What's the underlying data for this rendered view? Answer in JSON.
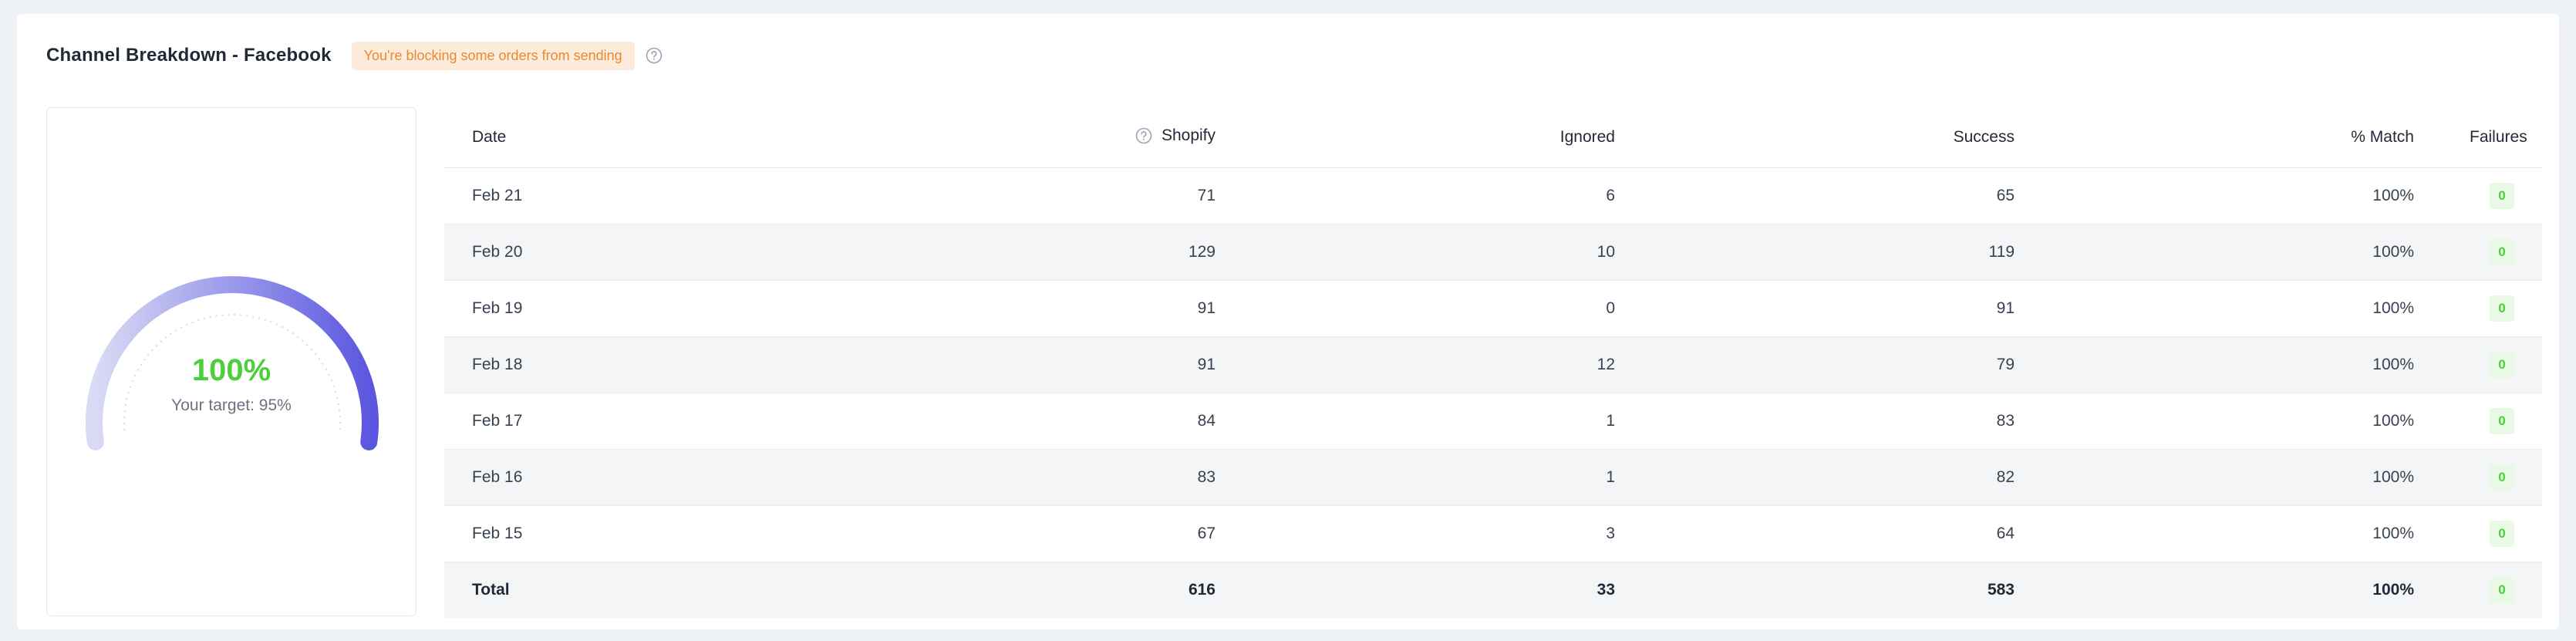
{
  "header": {
    "title": "Channel Breakdown - Facebook",
    "warning": "You're blocking some orders from sending"
  },
  "gauge": {
    "percent": 100,
    "value_label": "100%",
    "target_label": "Your target: 95%",
    "target_percent": 95,
    "colors": {
      "start": "#d9dbf5",
      "end": "#5b56e0",
      "value_text": "#4ccf3c"
    }
  },
  "table": {
    "columns": [
      "Date",
      "Shopify",
      "Ignored",
      "Success",
      "% Match",
      "Failures"
    ],
    "rows": [
      {
        "date": "Feb 21",
        "shopify": "71",
        "ignored": "6",
        "success": "65",
        "match": "100%",
        "failures": "0"
      },
      {
        "date": "Feb 20",
        "shopify": "129",
        "ignored": "10",
        "success": "119",
        "match": "100%",
        "failures": "0"
      },
      {
        "date": "Feb 19",
        "shopify": "91",
        "ignored": "0",
        "success": "91",
        "match": "100%",
        "failures": "0"
      },
      {
        "date": "Feb 18",
        "shopify": "91",
        "ignored": "12",
        "success": "79",
        "match": "100%",
        "failures": "0"
      },
      {
        "date": "Feb 17",
        "shopify": "84",
        "ignored": "1",
        "success": "83",
        "match": "100%",
        "failures": "0"
      },
      {
        "date": "Feb 16",
        "shopify": "83",
        "ignored": "1",
        "success": "82",
        "match": "100%",
        "failures": "0"
      },
      {
        "date": "Feb 15",
        "shopify": "67",
        "ignored": "3",
        "success": "64",
        "match": "100%",
        "failures": "0"
      }
    ],
    "total": {
      "date": "Total",
      "shopify": "616",
      "ignored": "33",
      "success": "583",
      "match": "100%",
      "failures": "0"
    }
  },
  "icons": {
    "header_help": "help-circle-icon",
    "shopify_help": "help-circle-icon"
  }
}
